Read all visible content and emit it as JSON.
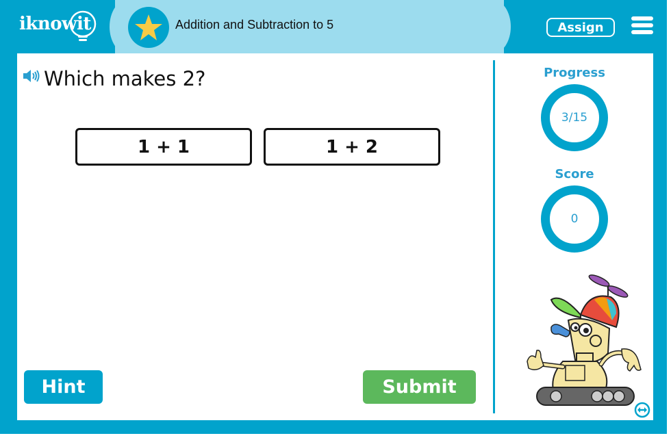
{
  "header": {
    "logo_text": "iknowit",
    "lesson_title": "Addition and Subtraction to 5",
    "assign_label": "Assign",
    "badge_icon": "star-icon",
    "menu_icon": "hamburger-menu-icon"
  },
  "question": {
    "audio_icon": "speaker-icon",
    "text": "Which makes 2?",
    "answers": [
      {
        "label": "1 + 1"
      },
      {
        "label": "1 + 2"
      }
    ]
  },
  "actions": {
    "hint_label": "Hint",
    "submit_label": "Submit"
  },
  "sidebar": {
    "progress_label": "Progress",
    "progress_value": "3/15",
    "progress_current": 3,
    "progress_total": 15,
    "score_label": "Score",
    "score_value": "0",
    "mascot": "robot-mascot",
    "expand_icon": "expand-arrows-icon"
  },
  "colors": {
    "brand_blue": "#01a3cc",
    "title_band": "#9cdcee",
    "star": "#f7cb45",
    "submit_green": "#5cb85c",
    "sidebar_text": "#2a9fd0"
  }
}
